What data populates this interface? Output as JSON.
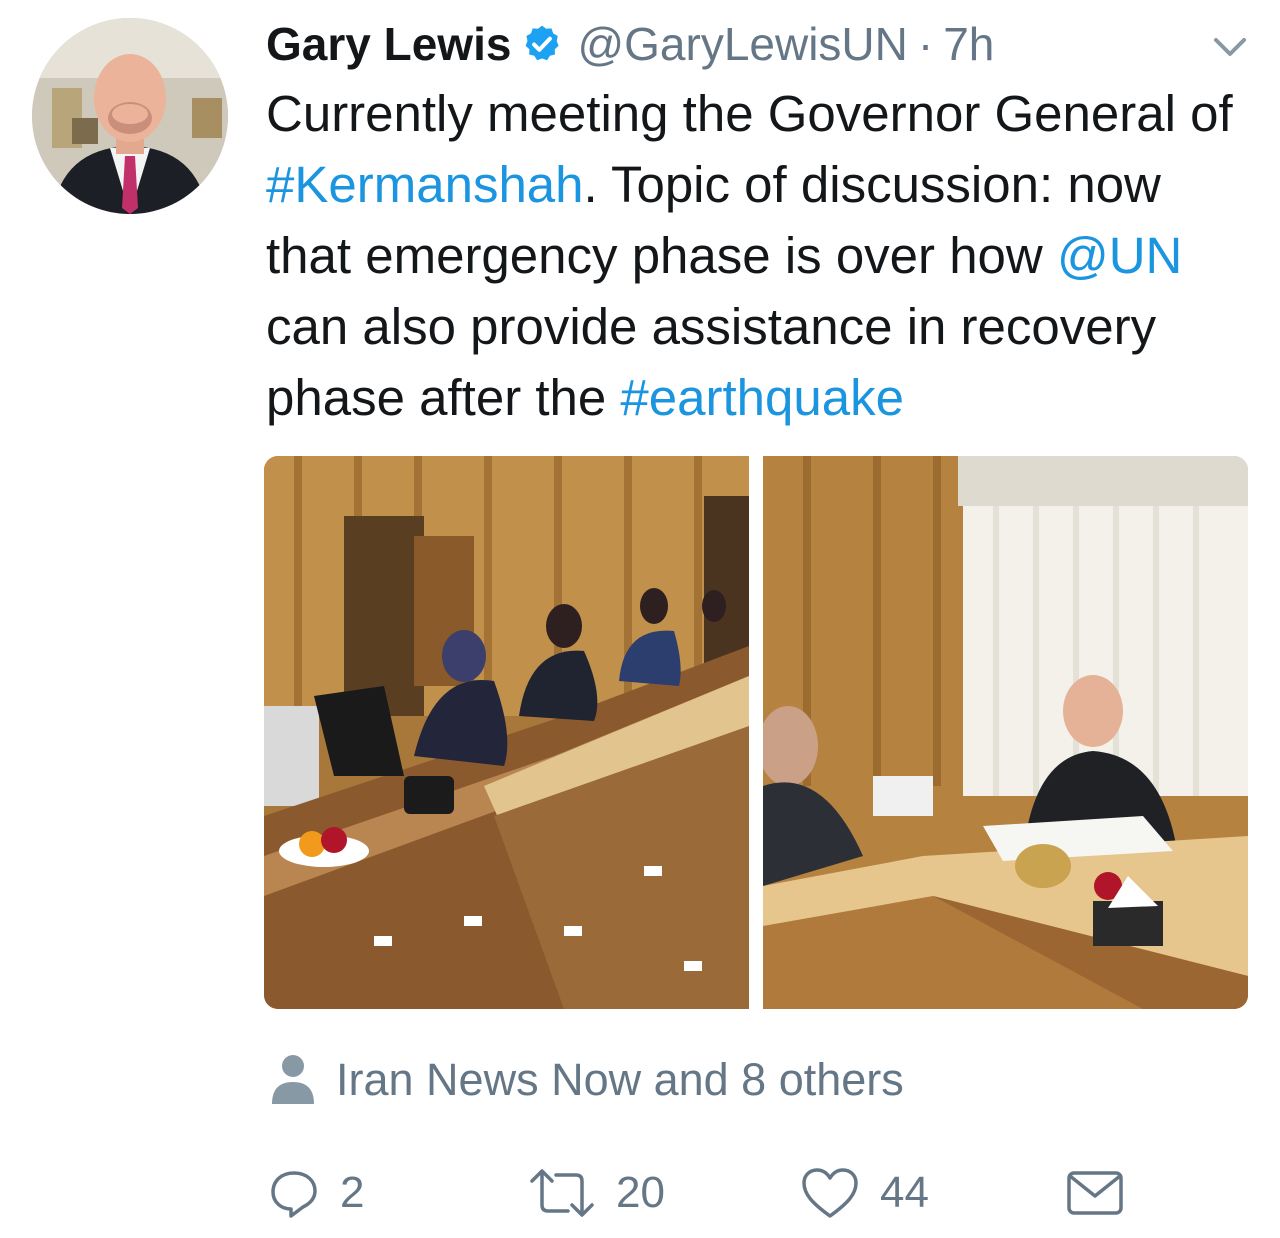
{
  "tweet": {
    "author_name": "Gary Lewis",
    "handle": "@GaryLewisUN",
    "separator": "·",
    "time": "7h",
    "text_segments": [
      {
        "text": "Currently meeting the Governor General of ",
        "link": false
      },
      {
        "text": "#Kermanshah",
        "link": true
      },
      {
        "text": ". Topic of discussion: now that emergency phase is over how ",
        "link": false
      },
      {
        "text": "@UN",
        "link": true
      },
      {
        "text": " can also provide assistance in recovery phase after the ",
        "link": false
      },
      {
        "text": "#earthquake",
        "link": true
      }
    ],
    "social_context": "Iran News Now and 8 others",
    "actions": {
      "reply_count": "2",
      "retweet_count": "20",
      "like_count": "44"
    }
  },
  "colors": {
    "text": "#14171a",
    "secondary": "#657786",
    "link": "#1b95e0",
    "verified": "#1da1f2"
  },
  "icons": {
    "verified": "verified-badge-icon",
    "menu": "chevron-down-icon",
    "social": "person-icon",
    "reply": "reply-icon",
    "retweet": "retweet-icon",
    "like": "heart-icon",
    "dm": "envelope-icon"
  }
}
